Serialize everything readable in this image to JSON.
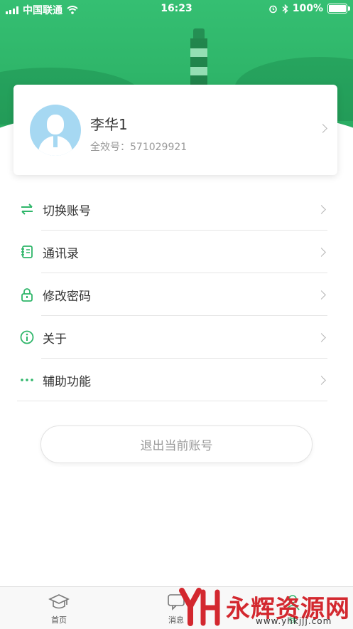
{
  "status_bar": {
    "carrier": "中国联通",
    "time": "16:23",
    "battery": "100%"
  },
  "profile": {
    "name": "李华1",
    "account_label": "全效号：",
    "account_number": "571029921"
  },
  "menu": [
    {
      "label": "切换账号",
      "icon": "switch-icon"
    },
    {
      "label": "通讯录",
      "icon": "contacts-icon"
    },
    {
      "label": "修改密码",
      "icon": "lock-icon"
    },
    {
      "label": "关于",
      "icon": "info-icon"
    },
    {
      "label": "辅助功能",
      "icon": "more-dots-icon"
    }
  ],
  "logout_label": "退出当前账号",
  "tabbar": {
    "home": "首页",
    "messages": "消息",
    "me": "我"
  },
  "watermark": {
    "text": "永辉资源网",
    "url": "www.yhkjjj.com"
  },
  "colors": {
    "accent": "#2fb66a",
    "watermark": "#d3282f"
  }
}
